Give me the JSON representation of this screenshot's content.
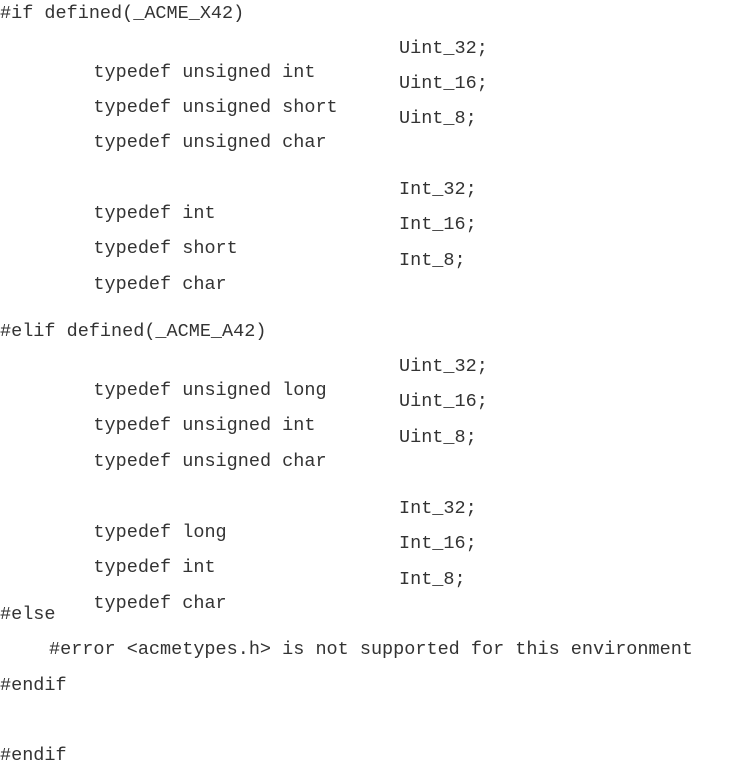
{
  "lines": {
    "if_directive": "#if defined(_ACME_X42)",
    "x42": [
      {
        "decl": "typedef unsigned int",
        "name": "Uint_32;"
      },
      {
        "decl": "typedef unsigned short",
        "name": "Uint_16;"
      },
      {
        "decl": "typedef unsigned char",
        "name": "Uint_8;"
      },
      {
        "decl": "typedef int",
        "name": "Int_32;"
      },
      {
        "decl": "typedef short",
        "name": "Int_16;"
      },
      {
        "decl": "typedef char",
        "name": "Int_8;"
      }
    ],
    "elif_directive": "#elif defined(_ACME_A42)",
    "a42": [
      {
        "decl": "typedef unsigned long",
        "name": "Uint_32;"
      },
      {
        "decl": "typedef unsigned int",
        "name": "Uint_16;"
      },
      {
        "decl": "typedef unsigned char",
        "name": "Uint_8;"
      },
      {
        "decl": "typedef long",
        "name": "Int_32;"
      },
      {
        "decl": "typedef int",
        "name": "Int_16;"
      },
      {
        "decl": "typedef char",
        "name": "Int_8;"
      }
    ],
    "else_directive": "#else",
    "error_directive": "#error <acmetypes.h> is not supported for this environment",
    "endif_directive_1": "#endif",
    "endif_directive_2": "#endif"
  }
}
